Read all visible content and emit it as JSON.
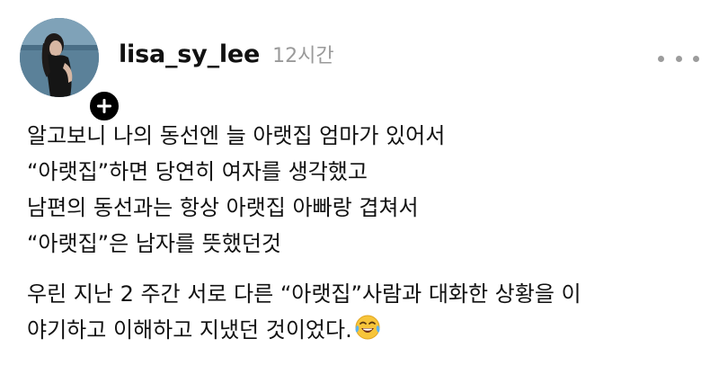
{
  "post": {
    "username": "lisa_sy_lee",
    "timestamp": "12시간",
    "avatar_icon": "profile-photo",
    "follow_icon": "plus-icon",
    "more_icon": "ellipsis-icon",
    "paragraphs": [
      {
        "lines": [
          "알고보니 나의 동선엔 늘 아랫집 엄마가 있어서",
          " “아랫집”하면 당연히 여자를 생각했고",
          "남편의 동선과는 항상 아랫집 아빠랑 겹쳐서",
          " “아랫집”은 남자를 뜻했던것"
        ]
      },
      {
        "lines": [
          "우린 지난 2 주간 서로 다른 “아랫집”사람과 대화한 상황을 이",
          "야기하고 이해하고 지냈던 것이었다."
        ],
        "trailing_emoji": "face-with-tears-of-joy"
      }
    ]
  },
  "colors": {
    "text": "#111111",
    "muted": "#9a9a9a",
    "badge": "#000000",
    "background": "#ffffff"
  }
}
